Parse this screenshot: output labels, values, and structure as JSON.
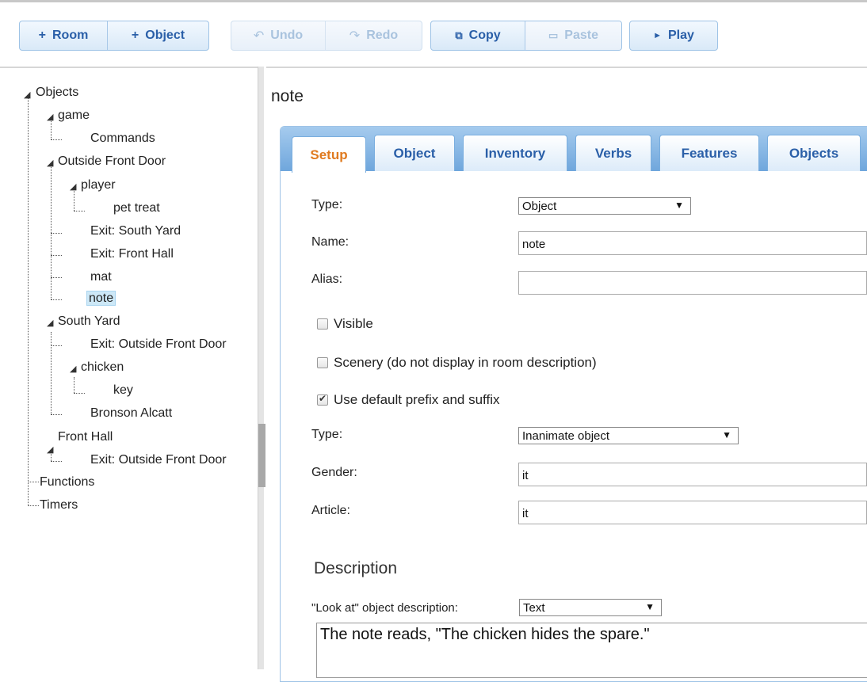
{
  "toolbar": {
    "room_label": "Room",
    "object_label": "Object",
    "undo_label": "Undo",
    "redo_label": "Redo",
    "copy_label": "Copy",
    "paste_label": "Paste",
    "play_label": "Play"
  },
  "tree": {
    "objects": "Objects",
    "game": "game",
    "commands": "Commands",
    "outside_front_door": "Outside Front Door",
    "player": "player",
    "pet_treat": "pet treat",
    "exit_south_yard": "Exit: South Yard",
    "exit_front_hall": "Exit: Front Hall",
    "mat": "mat",
    "note": "note",
    "south_yard": "South Yard",
    "exit_outside_front_door_1": "Exit: Outside Front Door",
    "chicken": "chicken",
    "key": "key",
    "bronson_alcatt": "Bronson Alcatt",
    "front_hall": "Front Hall",
    "exit_outside_front_door_2": "Exit: Outside Front Door",
    "functions": "Functions",
    "timers": "Timers"
  },
  "editor": {
    "object_name": "note",
    "tabs": [
      "Setup",
      "Object",
      "Inventory",
      "Verbs",
      "Features",
      "Objects"
    ],
    "active_tab": "Setup",
    "type_label": "Type:",
    "type_value": "Object",
    "name_label": "Name:",
    "name_value": "note",
    "alias_label": "Alias:",
    "alias_value": "",
    "visible_label": "Visible",
    "visible_checked": false,
    "scenery_label": "Scenery (do not display in room description)",
    "scenery_checked": false,
    "prefix_label": "Use default prefix and suffix",
    "prefix_checked": true,
    "type2_label": "Type:",
    "type2_value": "Inanimate object",
    "gender_label": "Gender:",
    "gender_value": "it",
    "article_label": "Article:",
    "article_value": "it",
    "description_title": "Description",
    "look_at_label": "\"Look at\" object description:",
    "look_at_value": "Text",
    "description_text": "The note reads, \"The chicken hides the spare.\""
  },
  "colors": {
    "accent_blue": "#2a5fa8",
    "active_tab_orange": "#e07a1f",
    "tab_bar_blue": "#6fa6dc",
    "selected_bg": "#cde8f7"
  }
}
